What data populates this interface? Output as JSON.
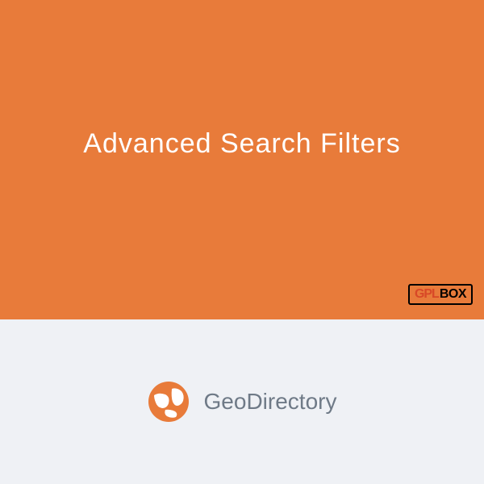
{
  "top": {
    "title": "Advanced Search Filters",
    "badge": {
      "gpl": "GPL",
      "box": "BOX"
    }
  },
  "bottom": {
    "brand": "GeoDirectory",
    "iconColor": "#e87b3a"
  }
}
